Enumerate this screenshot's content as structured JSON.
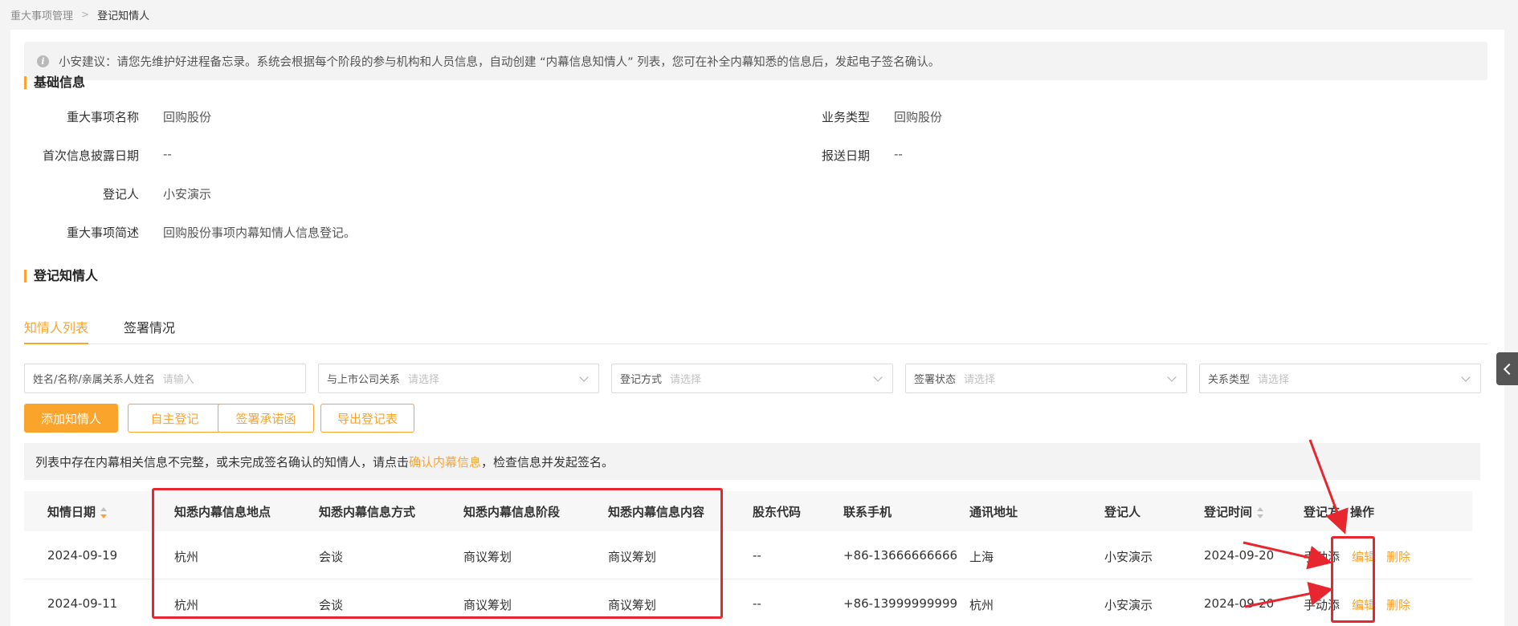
{
  "breadcrumb": {
    "parent": "重大事项管理",
    "current": "登记知情人"
  },
  "tip": {
    "text": "小安建议：请您先维护好进程备忘录。系统会根据每个阶段的参与机构和人员信息，自动创建 “内幕信息知情人” 列表，您可在补全内幕知悉的信息后，发起电子签名确认。"
  },
  "basic_info": {
    "title": "基础信息",
    "fields": [
      {
        "label": "重大事项名称",
        "value": "回购股份"
      },
      {
        "label": "业务类型",
        "value": "回购股份"
      },
      {
        "label": "首次信息披露日期",
        "value": "--"
      },
      {
        "label": "报送日期",
        "value": "--"
      },
      {
        "label": "登记人",
        "value": "小安演示"
      },
      {
        "label": "重大事项简述",
        "value": "回购股份事项内幕知情人信息登记。"
      }
    ]
  },
  "insiders": {
    "title": "登记知情人",
    "tabs": [
      {
        "label": "知情人列表"
      },
      {
        "label": "签署情况"
      }
    ]
  },
  "filters": [
    {
      "label": "姓名/名称/亲属关系人姓名",
      "placeholder": "请输入"
    },
    {
      "label": "与上市公司关系",
      "placeholder": "请选择"
    },
    {
      "label": "登记方式",
      "placeholder": "请选择"
    },
    {
      "label": "签署状态",
      "placeholder": "请选择"
    },
    {
      "label": "关系类型",
      "placeholder": "请选择"
    }
  ],
  "actions": {
    "add": "添加知情人",
    "self_register": "自主登记",
    "sign_letter": "签署承诺函",
    "export": "导出登记表"
  },
  "notice": {
    "before": "列表中存在内幕相关信息不完整，或未完成签名确认的知情人，请点击",
    "link": "确认内幕信息",
    "after": "，检查信息并发起签名。"
  },
  "table": {
    "columns": [
      "知情日期",
      "知悉内幕信息地点",
      "知悉内幕信息方式",
      "知悉内幕信息阶段",
      "知悉内幕信息内容",
      "股东代码",
      "联系手机",
      "通讯地址",
      "登记人",
      "登记时间",
      "登记方",
      "操作"
    ],
    "rows": [
      {
        "date": "2024-09-19",
        "place": "杭州",
        "method": "会谈",
        "stage": "商议筹划",
        "content": "商议筹划",
        "code": "--",
        "phone": "+86-13666666666",
        "address": "上海",
        "registrar": "小安演示",
        "reg_time": "2024-09-20",
        "reg_party": "手动添",
        "edit": "编辑",
        "delete": "删除"
      },
      {
        "date": "2024-09-11",
        "place": "杭州",
        "method": "会谈",
        "stage": "商议筹划",
        "content": "商议筹划",
        "code": "--",
        "phone": "+86-13999999999",
        "address": "杭州",
        "registrar": "小安演示",
        "reg_time": "2024-09-20",
        "reg_party": "手动添",
        "edit": "编辑",
        "delete": "删除"
      }
    ]
  },
  "colors": {
    "accent": "#fba42c",
    "annotation": "#e8262f"
  }
}
